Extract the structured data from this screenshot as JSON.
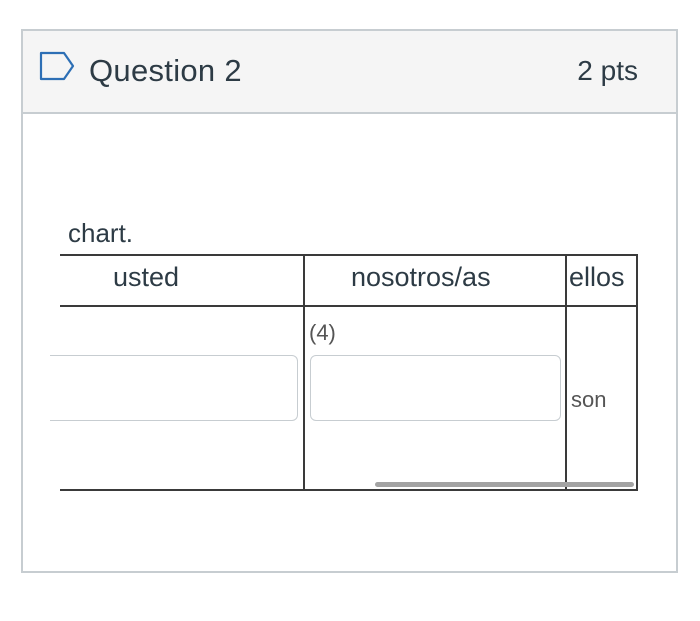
{
  "question": {
    "title": "Question 2",
    "points": "2 pts",
    "flag_icon": "bookmark-flag-icon"
  },
  "body": {
    "prompt_fragment": "chart."
  },
  "table": {
    "headers": [
      "usted",
      "nosotros/as",
      "ellos"
    ],
    "cells": {
      "nosotros_label": "(4)",
      "ellos_value": "son"
    },
    "inputs": {
      "usted_value": "",
      "nosotros_value": ""
    }
  },
  "colors": {
    "header_bg": "#f5f5f5",
    "border": "#c7cdd1",
    "text": "#2d3b45",
    "table_rule": "#3a3a3a",
    "scrollbar": "#a3a3a3"
  }
}
